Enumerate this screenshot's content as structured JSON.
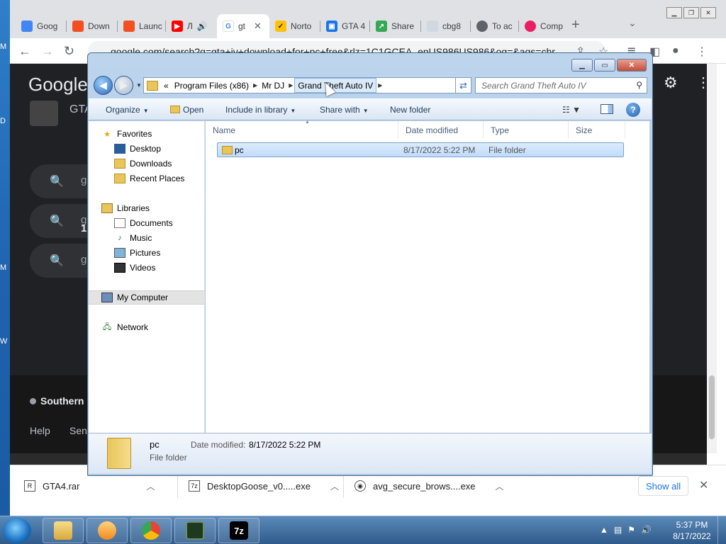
{
  "desktop": {
    "edge_letters": [
      "M",
      "D",
      "M",
      "W"
    ]
  },
  "chrome": {
    "tabs": [
      {
        "label": "Goog",
        "color": "#4285f4",
        "active": false
      },
      {
        "label": "Down",
        "color": "#f25022",
        "active": false
      },
      {
        "label": "Launc",
        "color": "#f25022",
        "active": false
      },
      {
        "label": "Л",
        "color": "#ff0000",
        "active": false
      },
      {
        "label": "gt",
        "color": "#4285f4",
        "active": true
      },
      {
        "label": "Norto",
        "color": "#ffc107",
        "active": false
      },
      {
        "label": "GTA 4",
        "color": "#1a73e8",
        "active": false
      },
      {
        "label": "Share",
        "color": "#34a853",
        "active": false
      },
      {
        "label": "cbg8",
        "color": "#9aa0a6",
        "active": false
      },
      {
        "label": "To ac",
        "color": "#5f6368",
        "active": false
      },
      {
        "label": "Comp",
        "color": "#e91e63",
        "active": false
      }
    ],
    "new_tab": "+",
    "address": "google.com/search?q=gta+iv+download+for+pc+free&rlz=1C1GCEA_enUS986US986&oq=&aqs=chr",
    "page": {
      "logo": "Google",
      "result_title": "GTA",
      "suggestions": [
        "g",
        "g",
        "g"
      ],
      "suggestion_sub": "1",
      "location": "Southern",
      "help": "Help",
      "send": "Sen"
    },
    "downloads": [
      {
        "name": "GTA4.rar"
      },
      {
        "name": "DesktopGoose_v0.....exe"
      },
      {
        "name": "avg_secure_brows....exe"
      }
    ],
    "show_all": "Show all"
  },
  "explorer": {
    "breadcrumbs": [
      "Program Files (x86)",
      "Mr DJ",
      "Grand Theft Auto IV"
    ],
    "breadcrumb_prefix": "«",
    "search_placeholder": "Search Grand Theft Auto IV",
    "commands": {
      "organize": "Organize",
      "open": "Open",
      "include": "Include in library",
      "share": "Share with",
      "new_folder": "New folder"
    },
    "nav": {
      "favorites": "Favorites",
      "desktop": "Desktop",
      "downloads": "Downloads",
      "recent": "Recent Places",
      "libraries": "Libraries",
      "documents": "Documents",
      "music": "Music",
      "pictures": "Pictures",
      "videos": "Videos",
      "computer": "My Computer",
      "network": "Network"
    },
    "columns": {
      "name": "Name",
      "date": "Date modified",
      "type": "Type",
      "size": "Size"
    },
    "files": [
      {
        "name": "pc",
        "date": "8/17/2022 5:22 PM",
        "type": "File folder",
        "size": ""
      }
    ],
    "details": {
      "name": "pc",
      "type": "File folder",
      "date_label": "Date modified:",
      "date_value": "8/17/2022 5:22 PM"
    }
  },
  "taskbar": {
    "time": "5:37 PM",
    "date": "8/17/2022",
    "apps": [
      "file-explorer",
      "media-player",
      "chrome",
      "task-manager",
      "7-zip"
    ]
  }
}
